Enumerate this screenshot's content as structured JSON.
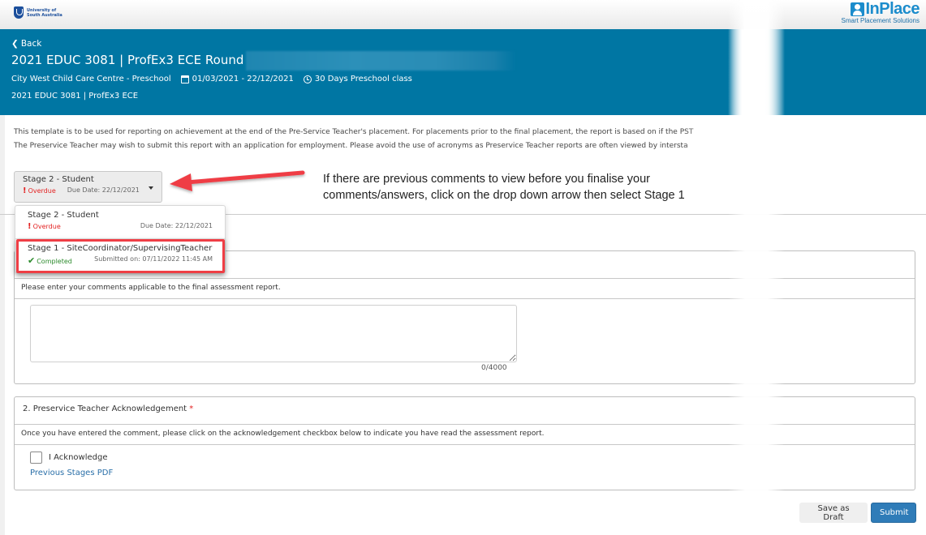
{
  "topbar": {
    "university_logo_line1": "University of",
    "university_logo_line2": "South Australia",
    "brand_name": "InPlace",
    "brand_tagline": "Smart Placement Solutions"
  },
  "header": {
    "back_label": "Back",
    "title": "2021 EDUC 3081 | ProfEx3 ECE Round 1 -",
    "location": "City West Child Care Centre - Preschool",
    "date_range": "01/03/2021 - 22/12/2021",
    "duration": "30 Days Preschool class",
    "subtitle": "2021 EDUC 3081 | ProfEx3 ECE"
  },
  "intro": {
    "line1": "This template is to be used for reporting on achievement at the end of the Pre-Service Teacher's placement. For placements prior to the final placement, the report is based on if the PST",
    "line2": "The Preservice Teacher may wish to submit this report with an application for employment. Please avoid the use of acronyms as Preservice Teacher reports are often viewed by intersta"
  },
  "stage_selector": {
    "selected": {
      "title": "Stage 2 - Student",
      "status": "Overdue",
      "due": "Due Date: 22/12/2021"
    },
    "options": [
      {
        "title": "Stage 2 - Student",
        "status": "Overdue",
        "meta": "Due Date: 22/12/2021"
      },
      {
        "title": "Stage 1 - SiteCoordinator/SupervisingTeacher",
        "status": "Completed",
        "meta": "Submitted on: 07/11/2022 11:45 AM"
      }
    ]
  },
  "annotation": {
    "line1": "If there are previous comments to view before you finalise your",
    "line2": "comments/answers, click on the drop down arrow then select Stage 1"
  },
  "questions": [
    {
      "title": "",
      "description": "Please enter your comments applicable to the final assessment report.",
      "input_value": "",
      "counter": "0/4000"
    },
    {
      "title": "2. Preservice Teacher Acknowledgement",
      "required_mark": "*",
      "description": "Once you have entered the comment, please click on the acknowledgement checkbox below to indicate you have read the assessment report.",
      "checkbox_label": "I Acknowledge",
      "checkbox_checked": false,
      "link_label": "Previous Stages PDF"
    }
  ],
  "actions": {
    "save_draft_label": "Save as Draft",
    "submit_label": "Submit"
  },
  "colors": {
    "header_bg": "#0076a3",
    "accent_blue": "#2f7cb8",
    "overdue_red": "#e32222",
    "completed_green": "#2b8a2b",
    "annotation_red": "#ef3e45"
  }
}
